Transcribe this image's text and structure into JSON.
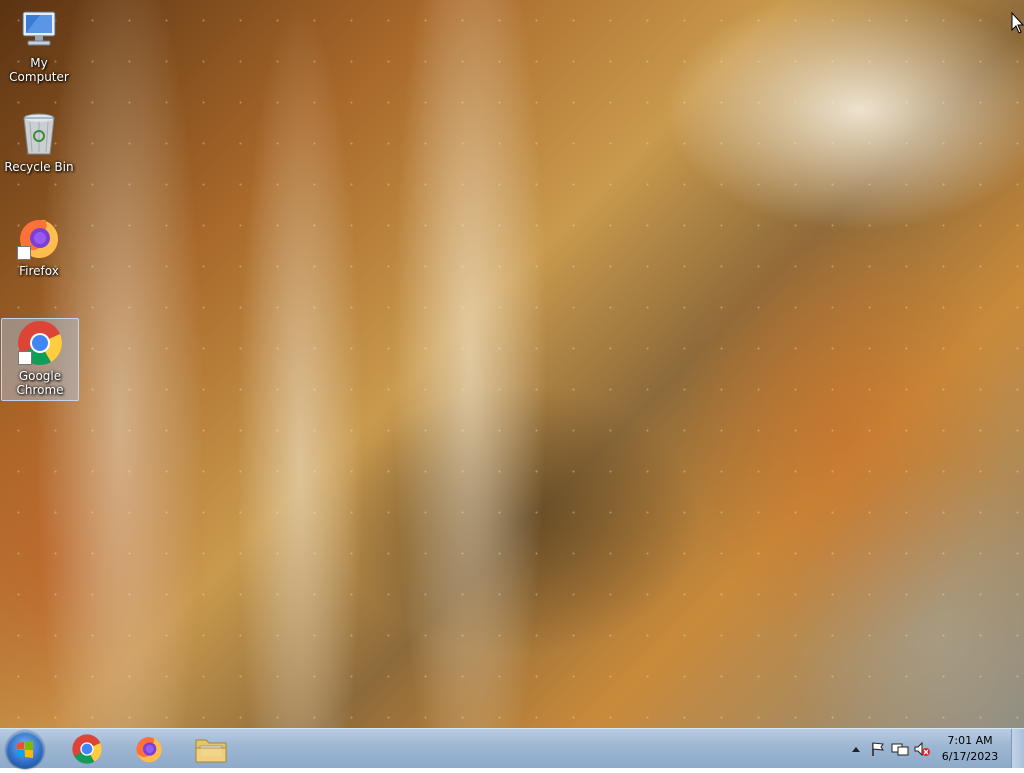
{
  "desktop": {
    "icons": [
      {
        "label": "My Computer",
        "icon": "computer-icon"
      },
      {
        "label": "Recycle Bin",
        "icon": "recycle-bin-icon"
      },
      {
        "label": "Firefox",
        "icon": "firefox-icon"
      },
      {
        "label": "Google Chrome",
        "icon": "chrome-icon",
        "selected": true
      }
    ]
  },
  "taskbar": {
    "start_icon": "windows-start-icon",
    "pinned": [
      {
        "name": "Google Chrome",
        "icon": "chrome-icon"
      },
      {
        "name": "Firefox",
        "icon": "firefox-icon"
      },
      {
        "name": "Windows Explorer",
        "icon": "folder-icon"
      }
    ],
    "tray": {
      "icons": [
        "show-hidden-icons-chevron-icon",
        "action-center-flag-icon",
        "network-icon",
        "volume-muted-icon"
      ],
      "time": "7:01 AM",
      "date": "6/17/2023"
    }
  },
  "colors": {
    "taskbar": "#9db6d2",
    "selection": "#aac8eb"
  }
}
